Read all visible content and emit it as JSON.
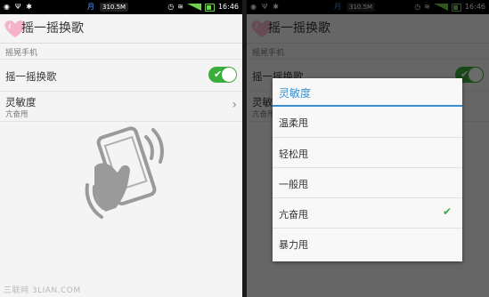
{
  "statusbar": {
    "carrier_badge": "月",
    "speed": "310.5M",
    "time": "16:46"
  },
  "app": {
    "title": "摇一摇换歌"
  },
  "settings": {
    "section_header": "摇晃手机",
    "shake_toggle_label": "摇一摇换歌",
    "shake_toggle_on": true,
    "sensitivity_label": "灵敏度",
    "sensitivity_value": "亢奋甩"
  },
  "dialog": {
    "title": "灵敏度",
    "options": [
      "温柔甩",
      "轻松甩",
      "一般甩",
      "亢奋甩",
      "暴力甩"
    ],
    "selected": "亢奋甩"
  },
  "watermark": "三联网 3LIAN.COM",
  "colors": {
    "accent_blue": "#3a8fd0",
    "toggle_green": "#3aad3a",
    "dim_overlay": "rgba(0,0,0,0.58)"
  },
  "icons": [
    "heart-icon",
    "shake-phone-icon",
    "chevron-right-icon",
    "check-icon",
    "wifi-icon",
    "signal-icon",
    "battery-icon",
    "usb-icon"
  ]
}
